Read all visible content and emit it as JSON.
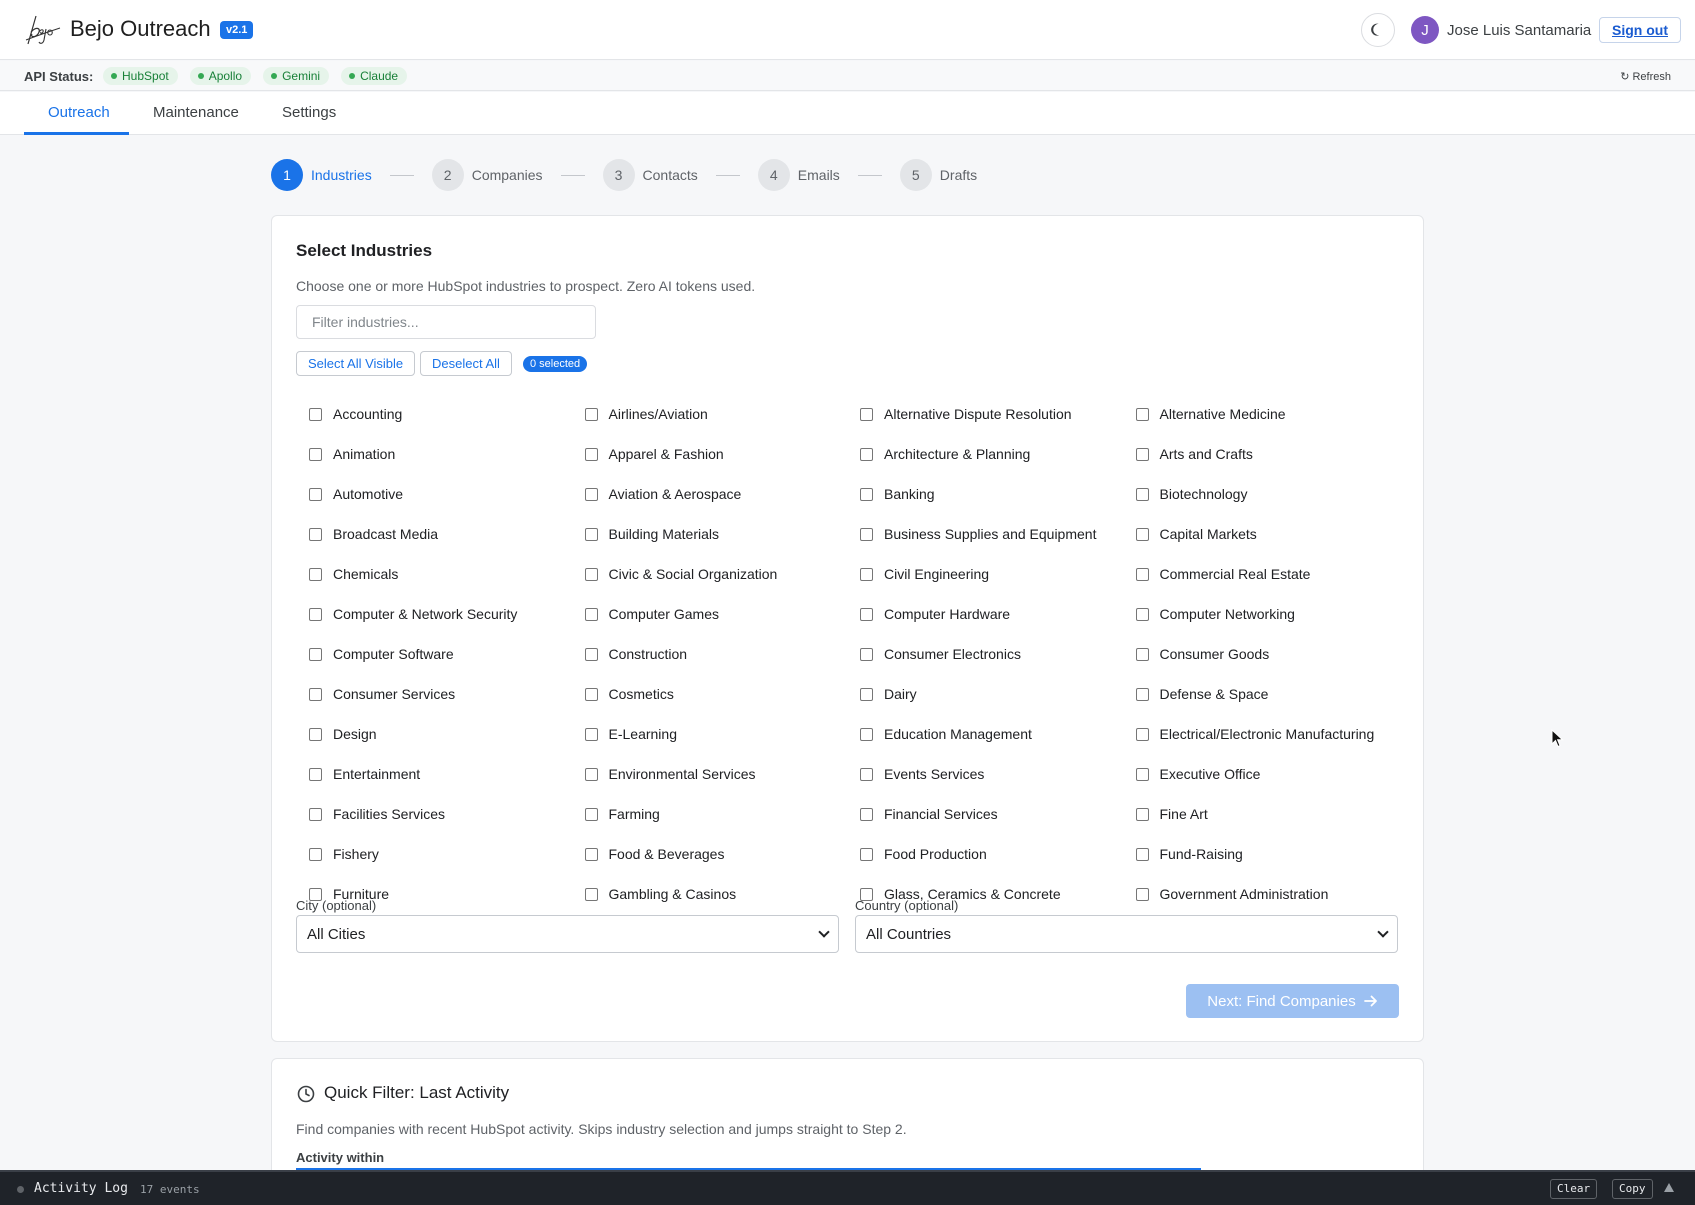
{
  "header": {
    "app_title": "Bejo Outreach",
    "version": "v2.1",
    "theme_icon": "moon-icon",
    "avatar_initial": "J",
    "user_name": "Jose Luis Santamaria",
    "signout_label": "Sign out"
  },
  "api_status": {
    "label": "API Status:",
    "services": [
      {
        "name": "HubSpot",
        "status_color": "#34a853"
      },
      {
        "name": "Apollo",
        "status_color": "#34a853"
      },
      {
        "name": "Gemini",
        "status_color": "#34a853"
      },
      {
        "name": "Claude",
        "status_color": "#34a853"
      }
    ],
    "refresh_label": "↻ Refresh"
  },
  "tabs": [
    {
      "label": "Outreach",
      "active": true
    },
    {
      "label": "Maintenance",
      "active": false
    },
    {
      "label": "Settings",
      "active": false
    }
  ],
  "stepper": [
    {
      "number": "1",
      "label": "Industries",
      "active": true
    },
    {
      "number": "2",
      "label": "Companies",
      "active": false
    },
    {
      "number": "3",
      "label": "Contacts",
      "active": false
    },
    {
      "number": "4",
      "label": "Emails",
      "active": false
    },
    {
      "number": "5",
      "label": "Drafts",
      "active": false
    }
  ],
  "industries_card": {
    "title": "Select Industries",
    "description": "Choose one or more HubSpot industries to prospect. Zero AI tokens used.",
    "filter_placeholder": "Filter industries...",
    "select_all_label": "Select All Visible",
    "deselect_all_label": "Deselect All",
    "selected_count": "0 selected",
    "industries": [
      "Accounting",
      "Airlines/Aviation",
      "Alternative Dispute Resolution",
      "Alternative Medicine",
      "Animation",
      "Apparel & Fashion",
      "Architecture & Planning",
      "Arts and Crafts",
      "Automotive",
      "Aviation & Aerospace",
      "Banking",
      "Biotechnology",
      "Broadcast Media",
      "Building Materials",
      "Business Supplies and Equipment",
      "Capital Markets",
      "Chemicals",
      "Civic & Social Organization",
      "Civil Engineering",
      "Commercial Real Estate",
      "Computer & Network Security",
      "Computer Games",
      "Computer Hardware",
      "Computer Networking",
      "Computer Software",
      "Construction",
      "Consumer Electronics",
      "Consumer Goods",
      "Consumer Services",
      "Cosmetics",
      "Dairy",
      "Defense & Space",
      "Design",
      "E-Learning",
      "Education Management",
      "Electrical/Electronic Manufacturing",
      "Entertainment",
      "Environmental Services",
      "Events Services",
      "Executive Office",
      "Facilities Services",
      "Farming",
      "Financial Services",
      "Fine Art",
      "Fishery",
      "Food & Beverages",
      "Food Production",
      "Fund-Raising",
      "Furniture",
      "Gambling & Casinos",
      "Glass, Ceramics & Concrete",
      "Government Administration"
    ],
    "city_label": "City (optional)",
    "city_value": "All Cities",
    "country_label": "Country (optional)",
    "country_value": "All Countries",
    "next_label": "Next: Find Companies"
  },
  "quick_filter": {
    "title": "Quick Filter: Last Activity",
    "description": "Find companies with recent HubSpot activity. Skips industry selection and jumps straight to Step 2.",
    "activity_label": "Activity within"
  },
  "activity_log": {
    "title": "Activity Log",
    "count": "17 events",
    "clear_label": "Clear",
    "copy_label": "Copy"
  }
}
